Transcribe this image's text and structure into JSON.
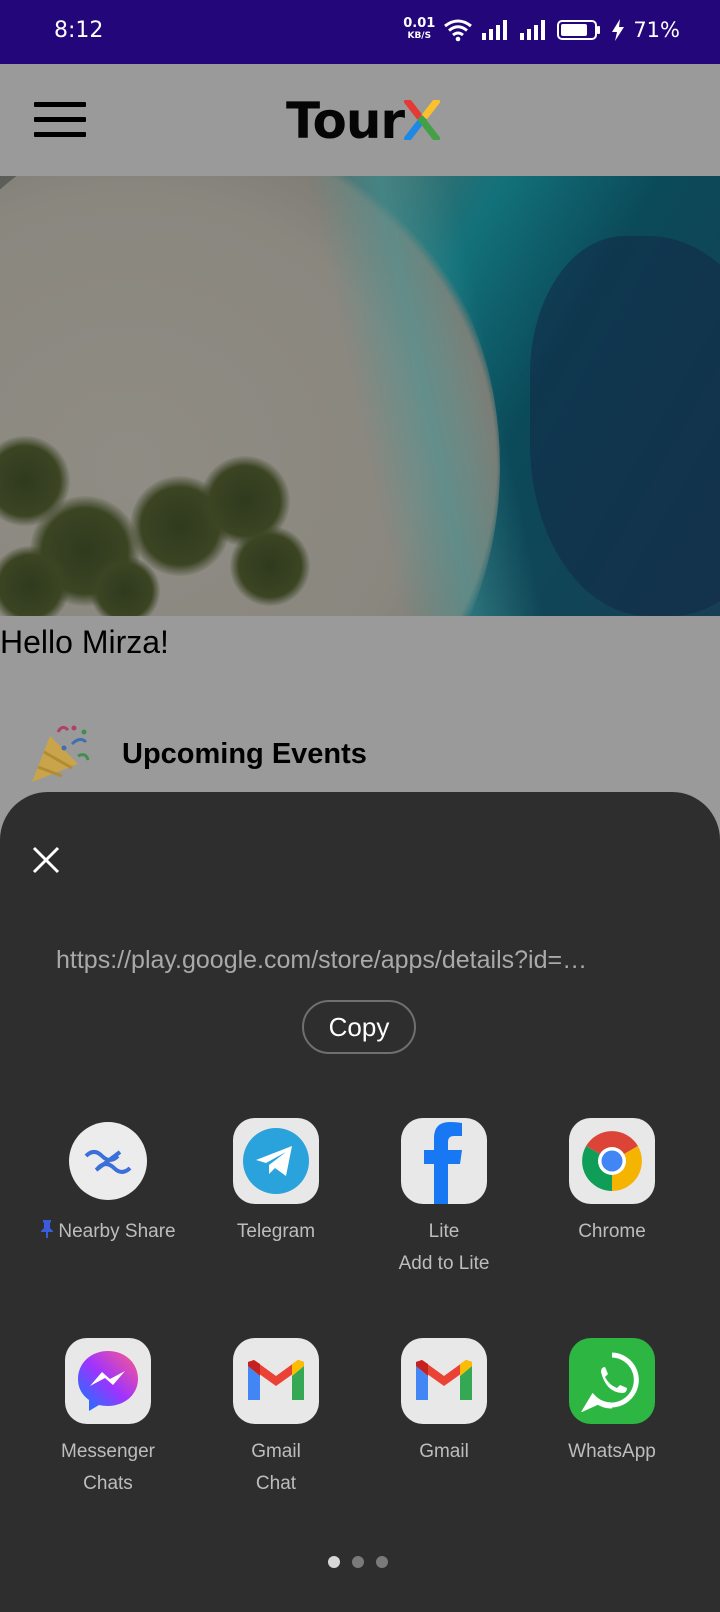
{
  "status_bar": {
    "time": "8:12",
    "net_speed_value": "0.01",
    "net_speed_unit": "KB/S",
    "battery_percent": "71%"
  },
  "header": {
    "logo_text": "Tour",
    "logo_x_colors": [
      "#e53935",
      "#fbc02d",
      "#43a047",
      "#1e88e5"
    ]
  },
  "content": {
    "greeting": "Hello Mirza!",
    "events_title": "Upcoming Events",
    "events_icon": "party-popper-icon"
  },
  "share_sheet": {
    "url": "https://play.google.com/store/apps/details?id=…",
    "copy_label": "Copy",
    "apps": [
      {
        "name": "Nearby Share",
        "pinned": true,
        "icon": "nearby-share-icon"
      },
      {
        "name": "Telegram",
        "icon": "telegram-icon"
      },
      {
        "name": "Lite",
        "sub": "Add to Lite",
        "icon": "facebook-icon"
      },
      {
        "name": "Chrome",
        "icon": "chrome-icon"
      },
      {
        "name": "Messenger",
        "sub": "Chats",
        "icon": "messenger-icon"
      },
      {
        "name": "Gmail",
        "sub": "Chat",
        "icon": "gmail-icon"
      },
      {
        "name": "Gmail",
        "icon": "gmail-icon"
      },
      {
        "name": "WhatsApp",
        "icon": "whatsapp-icon"
      }
    ],
    "page_dots": {
      "count": 3,
      "active": 1
    }
  }
}
